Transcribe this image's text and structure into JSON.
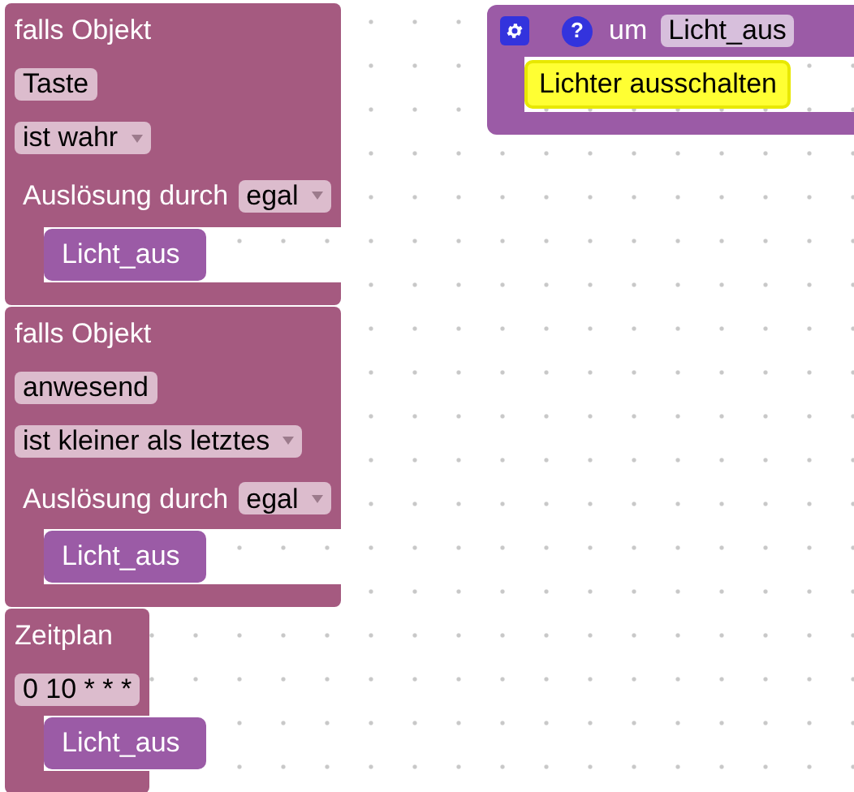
{
  "blocks": [
    {
      "title": "falls Objekt",
      "inputs": [
        {
          "kind": "text",
          "value": "Taste"
        },
        {
          "kind": "dropdown",
          "value": "ist wahr"
        },
        {
          "kind": "labeled_dropdown",
          "label": "Auslösung durch",
          "value": "egal"
        }
      ],
      "statements": [
        {
          "kind": "call",
          "label": "Licht_aus"
        }
      ]
    },
    {
      "title": "falls Objekt",
      "inputs": [
        {
          "kind": "text",
          "value": "anwesend"
        },
        {
          "kind": "dropdown",
          "value": "ist kleiner als letztes"
        },
        {
          "kind": "labeled_dropdown",
          "label": "Auslösung durch",
          "value": "egal"
        }
      ],
      "statements": [
        {
          "kind": "call",
          "label": "Licht_aus"
        }
      ]
    },
    {
      "title": "Zeitplan",
      "inputs": [
        {
          "kind": "text",
          "value": "0 10 * * *"
        }
      ],
      "statements": [
        {
          "kind": "call",
          "label": "Licht_aus"
        }
      ]
    }
  ],
  "procedure": {
    "help": "?",
    "label": "um",
    "name": "Licht_aus",
    "statements": [
      {
        "kind": "comment",
        "text": "Lichter ausschalten"
      }
    ]
  }
}
